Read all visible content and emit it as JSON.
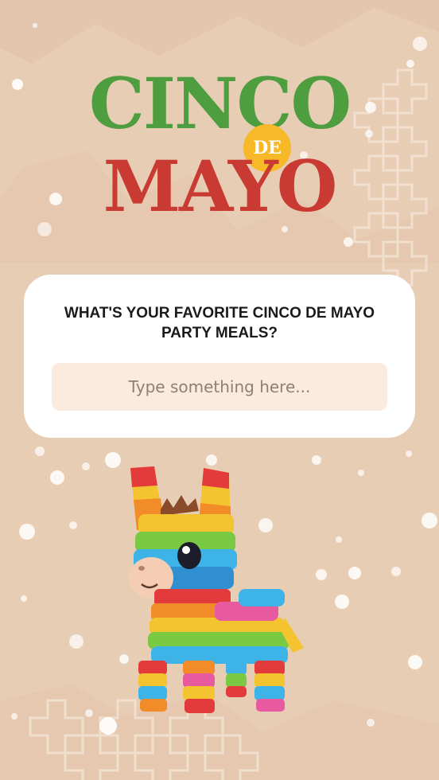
{
  "title": {
    "line1": "CINCO",
    "badge": "DE",
    "line2": "MAYO"
  },
  "card": {
    "question": "WHAT'S YOUR FAVORITE CINCO DE MAYO PARTY MEALS?",
    "input_placeholder": "Type something here...",
    "input_value": ""
  },
  "illustration": {
    "subject": "donkey-pinata",
    "colors": [
      "#e33b3b",
      "#f4c430",
      "#3db3e8",
      "#7ac943",
      "#f28c28",
      "#e85aa0"
    ]
  },
  "colors": {
    "background": "#e8cdb5",
    "green": "#4e9e3f",
    "red": "#c93a33",
    "yellow": "#f7b928",
    "card": "#ffffff",
    "field": "#fbeade"
  }
}
